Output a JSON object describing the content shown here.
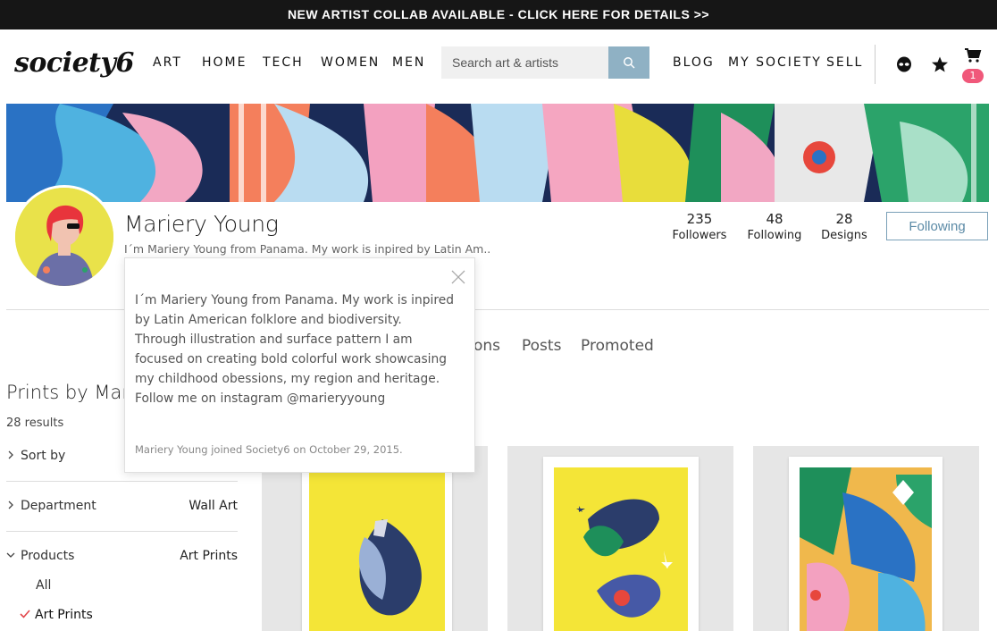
{
  "promo": {
    "text": "NEW ARTIST COLLAB AVAILABLE - CLICK HERE FOR DETAILS >>"
  },
  "header": {
    "logo": "society6",
    "nav_left": [
      "ART",
      "HOME",
      "TECH",
      "WOMEN",
      "MEN"
    ],
    "search_placeholder": "Search art & artists",
    "nav_right": [
      "BLOG",
      "MY SOCIETY",
      "SELL"
    ],
    "cart_count": "1"
  },
  "profile": {
    "name": "Mariery Young",
    "bio_short": "I´m Mariery Young from Panama. My work is inpired by Latin Am...",
    "stats": [
      {
        "value": "235",
        "label": "Followers"
      },
      {
        "value": "48",
        "label": "Following"
      },
      {
        "value": "28",
        "label": "Designs"
      }
    ],
    "follow_label": "Following"
  },
  "tabs": [
    "ons",
    "Posts",
    "Promoted"
  ],
  "sidebar": {
    "title": "Prints by Marie",
    "results": "28 results",
    "sort_label": "Sort by",
    "department_label": "Department",
    "department_value": "Wall Art",
    "products_label": "Products",
    "products_value": "Art Prints",
    "options": [
      "All",
      "Art Prints"
    ]
  },
  "popover": {
    "bio": "I´m Mariery Young from Panama. My work is inpired by Latin American folklore and biodiversity. Through illustration and surface pattern I am focused on creating bold colorful work showcasing my childhood obessions, my region and heritage. Follow me on instagram @marieryyoung",
    "joined": "Mariery Young joined Society6 on October 29, 2015."
  },
  "colors": {
    "accent": "#8fb1c4",
    "badge": "#f0587a",
    "print_yellow": "#f4e537"
  },
  "icons": [
    "search-icon",
    "alien-icon",
    "star-icon",
    "cart-icon",
    "close-icon",
    "chevron-right-icon",
    "chevron-down-icon",
    "checkmark-icon"
  ]
}
